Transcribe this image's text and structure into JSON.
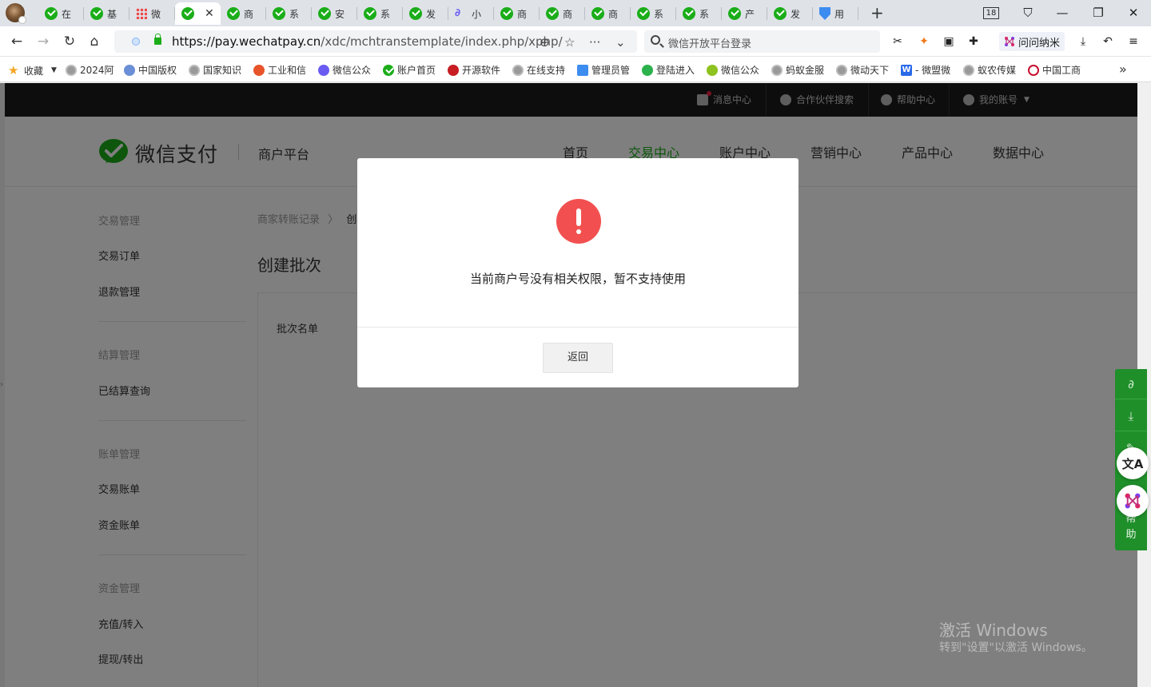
{
  "tabs": [
    {
      "label": "在",
      "icon": "wechat-pay-icon"
    },
    {
      "label": "基",
      "icon": "wechat-pay-icon"
    },
    {
      "label": "微",
      "icon": "grid-icon"
    },
    {
      "label": "",
      "icon": "wechat-pay-icon",
      "active": true
    },
    {
      "label": "商",
      "icon": "wechat-pay-icon"
    },
    {
      "label": "系",
      "icon": "wechat-pay-icon"
    },
    {
      "label": "安",
      "icon": "wechat-pay-icon"
    },
    {
      "label": "系",
      "icon": "wechat-pay-icon"
    },
    {
      "label": "发",
      "icon": "wechat-pay-icon"
    },
    {
      "label": "小",
      "icon": "link-icon"
    },
    {
      "label": "商",
      "icon": "wechat-pay-icon"
    },
    {
      "label": "商",
      "icon": "wechat-pay-icon"
    },
    {
      "label": "商",
      "icon": "wechat-pay-icon"
    },
    {
      "label": "系",
      "icon": "wechat-pay-icon"
    },
    {
      "label": "系",
      "icon": "wechat-pay-icon"
    },
    {
      "label": "产",
      "icon": "wechat-pay-icon"
    },
    {
      "label": "发",
      "icon": "wechat-pay-icon"
    },
    {
      "label": "用",
      "icon": "shield-icon"
    }
  ],
  "browser": {
    "tab_count": "18",
    "url_scheme_host": "https://pay.wechatpay.cn",
    "url_path": "/xdc/mchtranstemplate/index.php/xphp/",
    "search_text": "微信开放平台登录",
    "ext_label": "问问纳米"
  },
  "bookmarks": [
    {
      "label": "收藏",
      "icon": "star-icon"
    },
    {
      "label": "2024阿",
      "icon": "globe-icon"
    },
    {
      "label": "中国版权",
      "icon": "globe-icon"
    },
    {
      "label": "国家知识",
      "icon": "globe-icon"
    },
    {
      "label": "工业和信",
      "icon": "globe-icon"
    },
    {
      "label": "微信公众",
      "icon": "link-icon"
    },
    {
      "label": "账户首页",
      "icon": "wechat-pay-icon"
    },
    {
      "label": "开源软件",
      "icon": "gitee-icon"
    },
    {
      "label": "在线支持",
      "icon": "globe-icon"
    },
    {
      "label": "管理员管",
      "icon": "shield-icon"
    },
    {
      "label": "登陆进入",
      "icon": "globe-icon"
    },
    {
      "label": "微信公众",
      "icon": "globe-icon"
    },
    {
      "label": "蚂蚁金服",
      "icon": "globe-icon"
    },
    {
      "label": "微动天下",
      "icon": "globe-icon"
    },
    {
      "label": "- 微盟微",
      "icon": "w-icon"
    },
    {
      "label": "蚁农传媒",
      "icon": "globe-icon"
    },
    {
      "label": "中国工商",
      "icon": "icbc-icon"
    }
  ],
  "topbar": {
    "messages": "消息中心",
    "partner_search": "合作伙伴搜索",
    "help": "帮助中心",
    "account": "我的账号"
  },
  "header": {
    "logo_text": "微信支付",
    "platform": "商户平台",
    "nav": [
      "首页",
      "交易中心",
      "账户中心",
      "营销中心",
      "产品中心",
      "数据中心"
    ],
    "active_nav": "交易中心"
  },
  "sidebar": {
    "sections": [
      {
        "title": "交易管理",
        "items": [
          "交易订单",
          "退款管理"
        ]
      },
      {
        "title": "结算管理",
        "items": [
          "已结算查询"
        ]
      },
      {
        "title": "账单管理",
        "items": [
          "交易账单",
          "资金账单"
        ]
      },
      {
        "title": "资金管理",
        "items": [
          "充值/转入",
          "提现/转出"
        ]
      }
    ]
  },
  "main": {
    "breadcrumb_root": "商家转账记录",
    "breadcrumb_sep": "〉",
    "breadcrumb_current": "创",
    "title": "创建批次",
    "field_label": "批次名单"
  },
  "modal": {
    "message": "当前商户号没有相关权限，暂不支持使用",
    "back_label": "返回"
  },
  "floating": {
    "tail_text_1": "帮",
    "tail_text_2": "助"
  },
  "watermark": {
    "line1": "激活 Windows",
    "line2": "转到\"设置\"以激活 Windows。"
  },
  "colors": {
    "brand_green": "#1aad19",
    "alert_red": "#f25050",
    "topbar_bg": "#1b1b1b"
  }
}
